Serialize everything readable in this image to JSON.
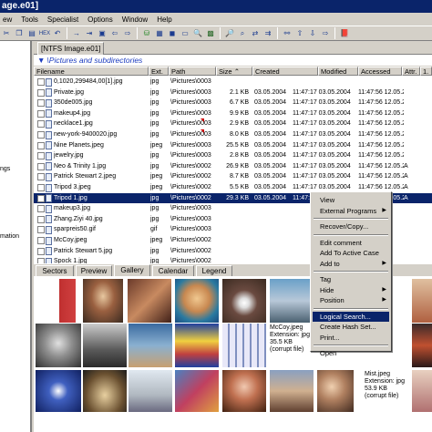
{
  "window": {
    "title": "age.e01]"
  },
  "menu": [
    "ew",
    "Tools",
    "Specialist",
    "Options",
    "Window",
    "Help"
  ],
  "tab": {
    "label": "[NTFS Image.e01]"
  },
  "path": {
    "label": "\\Pictures and subdirectories"
  },
  "left_pane": {
    "items": [
      "ngs",
      "mation"
    ]
  },
  "table": {
    "columns": [
      "Filename",
      "Ext.",
      "Path",
      "Size",
      "Created",
      "Modified",
      "Accessed",
      "Attr.",
      "1."
    ],
    "rows": [
      {
        "name": "0,1020,299484,00[1].jpg",
        "ext": "jpg",
        "path": "\\Pictures\\0003",
        "size": "",
        "created": "",
        "modified": "",
        "accessed": "",
        "attr": "",
        "extra": "",
        "mark": false
      },
      {
        "name": "Private.jpg",
        "ext": "jpg",
        "path": "\\Pictures\\0003",
        "size": "2.1 KB",
        "created": "03.05.2004",
        "modified": "11:47:17 03.05.2004",
        "accessed": "11:47:56 12.05.2005",
        "attr": "",
        "extra": "",
        "mark": false
      },
      {
        "name": "350de005.jpg",
        "ext": "jpg",
        "path": "\\Pictures\\0003",
        "size": "6.7 KB",
        "created": "03.05.2004",
        "modified": "11:47:17 03.05.2004",
        "accessed": "11:47:56 12.05.2005",
        "attr": "",
        "extra": "",
        "mark": false
      },
      {
        "name": "makeup4.jpg",
        "ext": "jpg",
        "path": "\\Pictures\\0003",
        "size": "9.9 KB",
        "created": "03.05.2004",
        "modified": "11:47:17 03.05.2004",
        "accessed": "11:47:56 12.05.2005",
        "attr": "",
        "extra": "",
        "mark": false
      },
      {
        "name": "necklace1.jpg",
        "ext": "jpg",
        "path": "\\Pictures\\0003",
        "size": "2.9 KB",
        "created": "03.05.2004",
        "modified": "11:47:17 03.05.2004",
        "accessed": "11:47:56 12.05.2005",
        "attr": "",
        "extra": "",
        "mark": true
      },
      {
        "name": "new-york-9400020.jpg",
        "ext": "jpg",
        "path": "\\Pictures\\0003",
        "size": "8.0 KB",
        "created": "03.05.2004",
        "modified": "11:47:17 03.05.2004",
        "accessed": "11:47:56 12.05.2005",
        "attr": "",
        "extra": "",
        "mark": true
      },
      {
        "name": "Nine Planets.jpeg",
        "ext": "jpeg",
        "path": "\\Pictures\\0003",
        "size": "25.5 KB",
        "created": "03.05.2004",
        "modified": "11:47:17 03.05.2004",
        "accessed": "11:47:56 12.05.2005",
        "attr": "",
        "extra": "",
        "mark": false
      },
      {
        "name": "jewelry.jpg",
        "ext": "jpg",
        "path": "\\Pictures\\0003",
        "size": "2.8 KB",
        "created": "03.05.2004",
        "modified": "11:47:17 03.05.2004",
        "accessed": "11:47:56 12.05.2005",
        "attr": "",
        "extra": "",
        "mark": false
      },
      {
        "name": "Neo & Trinity 1.jpg",
        "ext": "jpg",
        "path": "\\Pictures\\0002",
        "size": "26.9 KB",
        "created": "03.05.2004",
        "modified": "11:47:17 03.05.2004",
        "accessed": "11:47:56 12.05.2005",
        "attr": "A",
        "extra": "",
        "mark": false
      },
      {
        "name": "Patrick Stewart 2.jpeg",
        "ext": "jpeg",
        "path": "\\Pictures\\0002",
        "size": "8.7 KB",
        "created": "03.05.2004",
        "modified": "11:47:17 03.05.2004",
        "accessed": "11:47:56 12.05.2005",
        "attr": "A",
        "extra": "",
        "mark": false
      },
      {
        "name": "Tripod 3.jpeg",
        "ext": "jpeg",
        "path": "\\Pictures\\0002",
        "size": "5.5 KB",
        "created": "03.05.2004",
        "modified": "11:47:17 03.05.2004",
        "accessed": "11:47:56 12.05.2005",
        "attr": "A",
        "extra": "",
        "mark": false
      },
      {
        "name": "Tripod 1.jpg",
        "ext": "jpg",
        "path": "\\Pictures\\0002",
        "size": "29.3 KB",
        "created": "03.05.2004",
        "modified": "11:47:17 03.05.2004",
        "accessed": "11:47:56 12.05.2005",
        "attr": "A",
        "extra": "",
        "mark": false
      },
      {
        "name": "makeup3.jpg",
        "ext": "jpg",
        "path": "\\Pictures\\0003",
        "size": "",
        "created": "",
        "modified": "",
        "accessed": "",
        "attr": "",
        "extra": "",
        "mark": false
      },
      {
        "name": "Zhang.Ziyi 40.jpg",
        "ext": "jpg",
        "path": "\\Pictures\\0003",
        "size": "",
        "created": "",
        "modified": "",
        "accessed": "",
        "attr": "",
        "extra": "",
        "mark": false
      },
      {
        "name": "sparpreis50.gif",
        "ext": "gif",
        "path": "\\Pictures\\0003",
        "size": "",
        "created": "",
        "modified": "",
        "accessed": "",
        "attr": "",
        "extra": "",
        "mark": false
      },
      {
        "name": "McCoy.jpeg",
        "ext": "jpeg",
        "path": "\\Pictures\\0002",
        "size": "",
        "created": "",
        "modified": "",
        "accessed": "",
        "attr": "",
        "extra": "",
        "mark": false
      },
      {
        "name": "Patrick Stewart 5.jpg",
        "ext": "jpg",
        "path": "\\Pictures\\0002",
        "size": "",
        "created": "",
        "modified": "",
        "accessed": "",
        "attr": "",
        "extra": "",
        "mark": false
      },
      {
        "name": "Spock 1.jpg",
        "ext": "jpg",
        "path": "\\Pictures\\0002",
        "size": "",
        "created": "",
        "modified": "",
        "accessed": "",
        "attr": "",
        "extra": "",
        "mark": false
      }
    ],
    "selected_index": 11
  },
  "view_tabs": [
    "Sectors",
    "Preview",
    "Gallery",
    "Calendar",
    "Legend"
  ],
  "active_view_tab": "Gallery",
  "gallery": {
    "mccoy": {
      "name": "McCoy.jpeg",
      "ext": "Extension: jpg",
      "size": "35.5 KB",
      "note": "(corrupt file)"
    },
    "mist": {
      "name": "Mist.jpeg",
      "ext": "Extension: jpg",
      "size": "53.9 KB",
      "note": "(corrupt file)"
    }
  },
  "context_menu": {
    "items": [
      {
        "label": "View",
        "sub": false
      },
      {
        "label": "External Programs",
        "sub": true
      },
      {
        "sep": true
      },
      {
        "label": "Recover/Copy...",
        "sub": false
      },
      {
        "sep": true
      },
      {
        "label": "Edit comment",
        "sub": false
      },
      {
        "label": "Add To Active Case",
        "sub": false
      },
      {
        "label": "Add to",
        "sub": true
      },
      {
        "sep": true
      },
      {
        "label": "Tag",
        "sub": false
      },
      {
        "label": "Hide",
        "sub": true
      },
      {
        "label": "Position",
        "sub": true
      },
      {
        "sep": true
      },
      {
        "label": "Logical Search...",
        "sub": false,
        "hl": true
      },
      {
        "label": "Create Hash Set...",
        "sub": false
      },
      {
        "label": "Print...",
        "sub": false
      },
      {
        "sep": true
      },
      {
        "label": "Open",
        "sub": false
      }
    ]
  },
  "colors": {
    "selection": "#0a246a",
    "title": "#0a246a",
    "path_text": "#1b3bbf",
    "chrome": "#d4d0c8"
  }
}
